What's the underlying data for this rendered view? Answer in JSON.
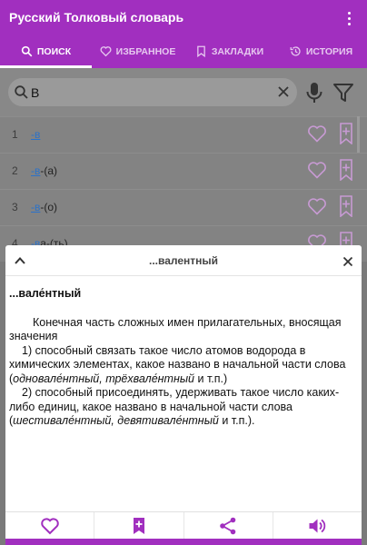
{
  "app": {
    "title": "Русский Толковый словарь"
  },
  "colors": {
    "primary": "#a12fbf",
    "accent_link": "#2b72c9",
    "icon_pink": "#c79ad3"
  },
  "tabs": [
    {
      "label": "ПОИСК",
      "icon": "search-icon",
      "active": true
    },
    {
      "label": "ИЗБРАННОЕ",
      "icon": "heart-icon",
      "active": false
    },
    {
      "label": "ЗАКЛАДКИ",
      "icon": "bookmark-icon",
      "active": false
    },
    {
      "label": "ИСТОРИЯ",
      "icon": "history-icon",
      "active": false
    }
  ],
  "search": {
    "value": "В"
  },
  "results": [
    {
      "num": "1",
      "prefix": "",
      "highlight": "-в",
      "suffix": ""
    },
    {
      "num": "2",
      "prefix": "",
      "highlight": "-в",
      "suffix": "-(а)"
    },
    {
      "num": "3",
      "prefix": "",
      "highlight": "-в",
      "suffix": "-(о)"
    },
    {
      "num": "4",
      "prefix": "",
      "highlight": "-в",
      "suffix": "а-(ть)"
    }
  ],
  "panel": {
    "title": "...валентный",
    "headword": "...вале́нтный",
    "definition_intro": "Конечная часть сложных имен прилагательных, вносящая значения",
    "sense1_text": "1) способный связать такое число атомов водорода в химических элементах, какое названо в начальной части слова (",
    "sense1_examples": "одновале́нтный, трёхвале́нтный",
    "sense1_end": " и т.п.)",
    "sense2_text": "2) способный присоединять, удерживать такое число каких-либо единиц, какое названо в начальной части слова (",
    "sense2_examples": "шестивале́нтный, девятивале́нтный",
    "sense2_end": " и т.п.)."
  },
  "footer": [
    {
      "icon": "heart-icon"
    },
    {
      "icon": "bookmark-add-icon"
    },
    {
      "icon": "share-icon"
    },
    {
      "icon": "speaker-icon"
    }
  ]
}
